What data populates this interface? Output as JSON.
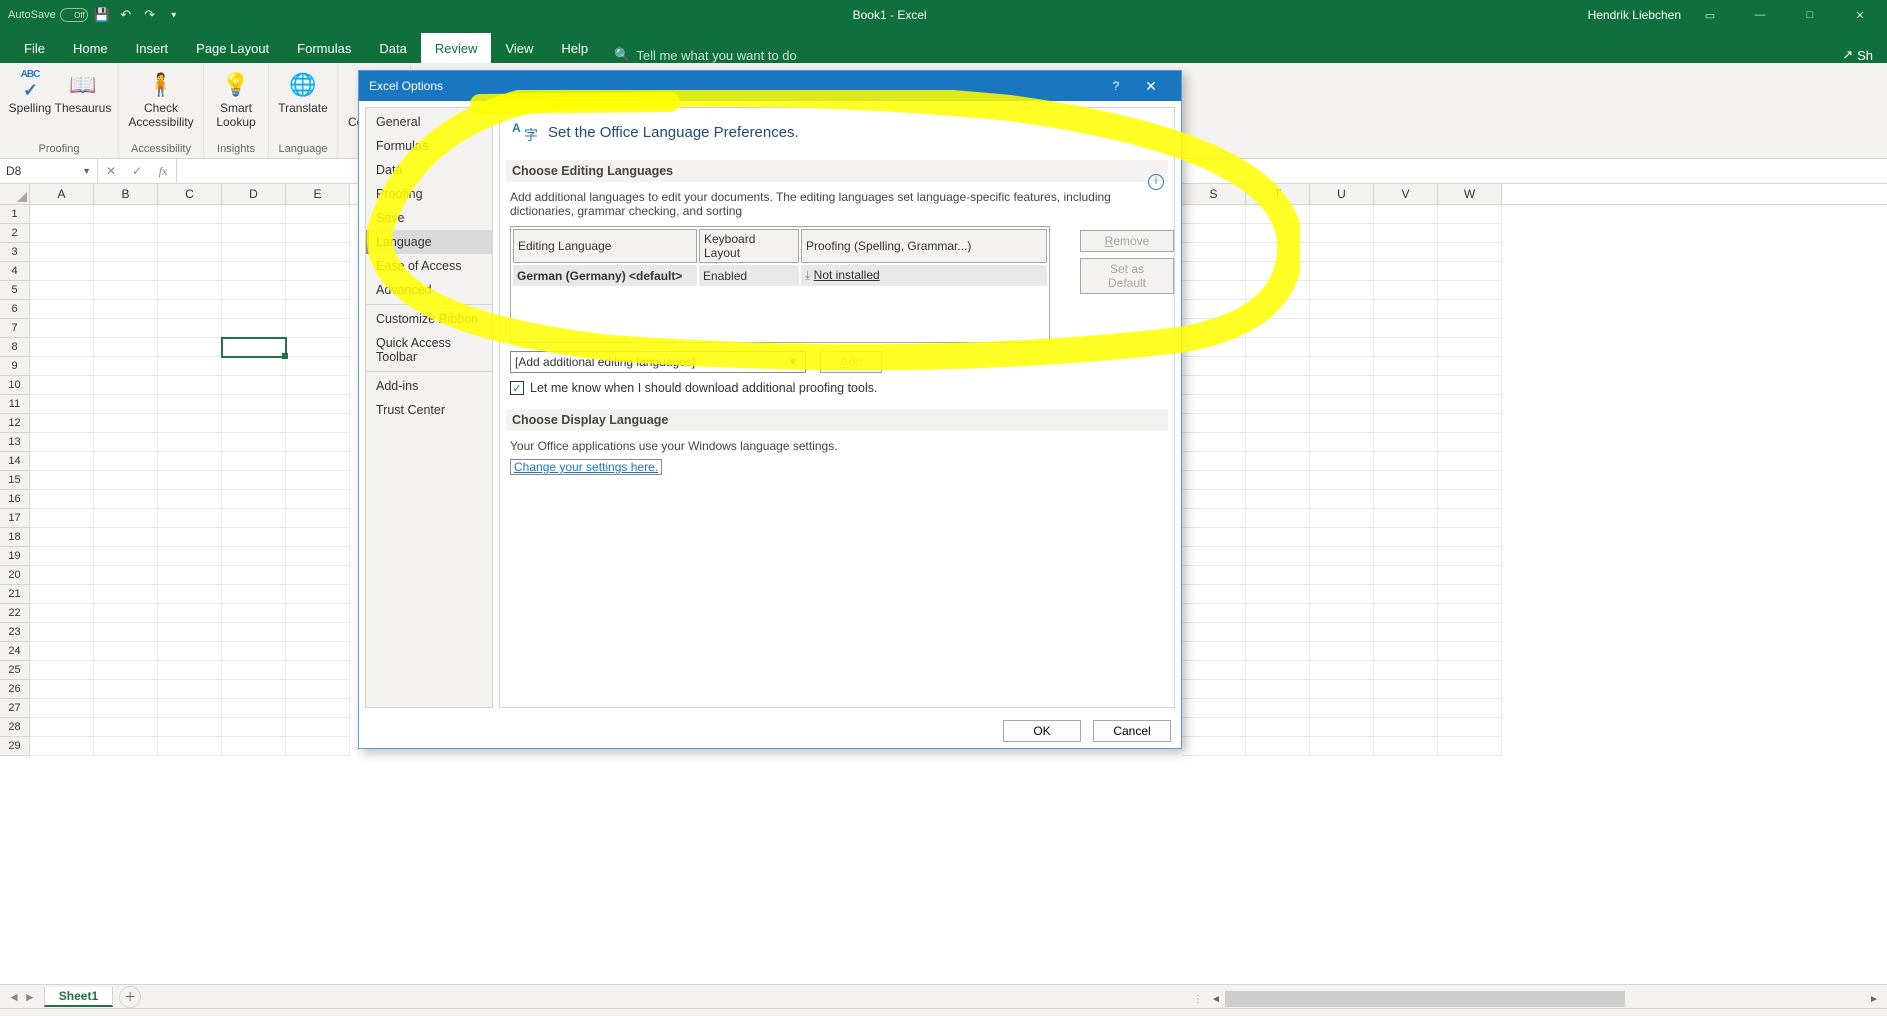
{
  "titlebar": {
    "autosave_label": "AutoSave",
    "autosave_state": "Off",
    "document_title": "Book1 - Excel",
    "user": "Hendrik Liebchen"
  },
  "ribbon_tabs": {
    "file": "File",
    "home": "Home",
    "insert": "Insert",
    "page_layout": "Page Layout",
    "formulas": "Formulas",
    "data": "Data",
    "review": "Review",
    "view": "View",
    "help": "Help",
    "tellme": "Tell me what you want to do",
    "share": "Sh"
  },
  "ribbon": {
    "spelling": "Spelling",
    "thesaurus": "Thesaurus",
    "proofing_group": "Proofing",
    "check_access": "Check\nAccessibility",
    "access_group": "Accessibility",
    "smart_lookup": "Smart\nLookup",
    "insights_group": "Insights",
    "translate": "Translate",
    "language_group": "Language",
    "new_comment": "New\nComment"
  },
  "formula_bar": {
    "namebox": "D8"
  },
  "columns": [
    "A",
    "B",
    "C",
    "D",
    "E",
    "S",
    "T",
    "U",
    "V",
    "W"
  ],
  "selected_cell": "D8",
  "sheet_tab": "Sheet1",
  "dialog": {
    "title": "Excel Options",
    "nav": {
      "general": "General",
      "formulas": "Formulas",
      "data": "Data",
      "proofing": "Proofing",
      "save": "Save",
      "language": "Language",
      "ease": "Ease of Access",
      "advanced": "Advanced",
      "customize": "Customize Ribbon",
      "qat": "Quick Access Toolbar",
      "addins": "Add-ins",
      "trust": "Trust Center"
    },
    "heading": "Set the Office Language Preferences.",
    "section1_title": "Choose Editing Languages",
    "section1_desc": "Add additional languages to edit your documents. The editing languages set language-specific features, including dictionaries, grammar checking, and sorting",
    "table": {
      "h1": "Editing Language",
      "h2": "Keyboard Layout",
      "h3": "Proofing (Spelling, Grammar...)",
      "row_lang": "German (Germany) <default>",
      "row_kb": "Enabled",
      "row_proof": "Not installed"
    },
    "btn_remove": "Remove",
    "btn_default": "Set as Default",
    "combo": "[Add additional editing languages]",
    "btn_add": "Add",
    "chk_label": "Let me know when I should download additional proofing tools.",
    "section2_title": "Choose Display Language",
    "section2_desc": "Your Office applications use your Windows language settings.",
    "link": "Change your settings here.",
    "ok": "OK",
    "cancel": "Cancel"
  }
}
